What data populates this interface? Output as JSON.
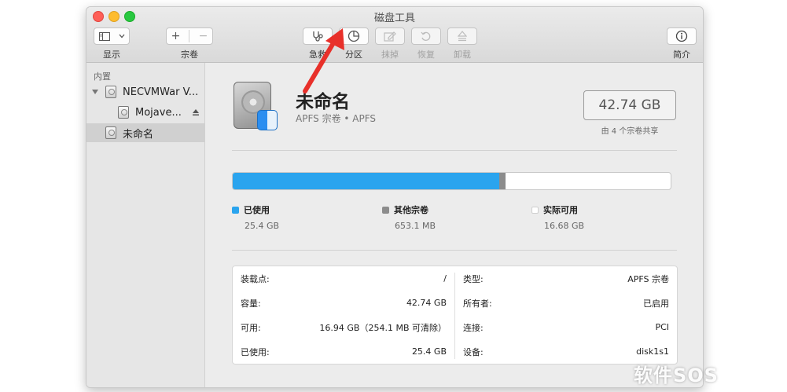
{
  "window": {
    "title": "磁盘工具"
  },
  "toolbar": {
    "view_label": "显示",
    "volume_label": "宗卷",
    "volume_add": "+",
    "volume_remove": "−",
    "firstaid_label": "急救",
    "partition_label": "分区",
    "erase_label": "抹掉",
    "restore_label": "恢复",
    "unmount_label": "卸载",
    "info_label": "简介"
  },
  "sidebar": {
    "section": "内置",
    "items": [
      {
        "label": "NECVMWar V..."
      },
      {
        "label": "Mojave..."
      },
      {
        "label": "未命名"
      }
    ]
  },
  "volume": {
    "name": "未命名",
    "subtitle": "APFS 宗卷 • APFS",
    "size": "42.74 GB",
    "size_note": "由 4 个宗卷共享"
  },
  "usage": {
    "used_fraction": 0.6079,
    "other_fraction": 0.0156,
    "legend": [
      {
        "label": "已使用",
        "value": "25.4 GB",
        "color": "#2aa4ee"
      },
      {
        "label": "其他宗卷",
        "value": "653.1 MB",
        "color": "#8c8c8c"
      },
      {
        "label": "实际可用",
        "value": "16.68 GB",
        "color": "#ffffff"
      }
    ]
  },
  "info": {
    "left": [
      {
        "key": "装载点:",
        "value": "/"
      },
      {
        "key": "容量:",
        "value": "42.74 GB"
      },
      {
        "key": "可用:",
        "value": "16.94 GB（254.1 MB 可清除）"
      },
      {
        "key": "已使用:",
        "value": "25.4 GB"
      }
    ],
    "right": [
      {
        "key": "类型:",
        "value": "APFS 宗卷"
      },
      {
        "key": "所有者:",
        "value": "已启用"
      },
      {
        "key": "连接:",
        "value": "PCI"
      },
      {
        "key": "设备:",
        "value": "disk1s1"
      }
    ]
  },
  "watermark": "软件SOS"
}
